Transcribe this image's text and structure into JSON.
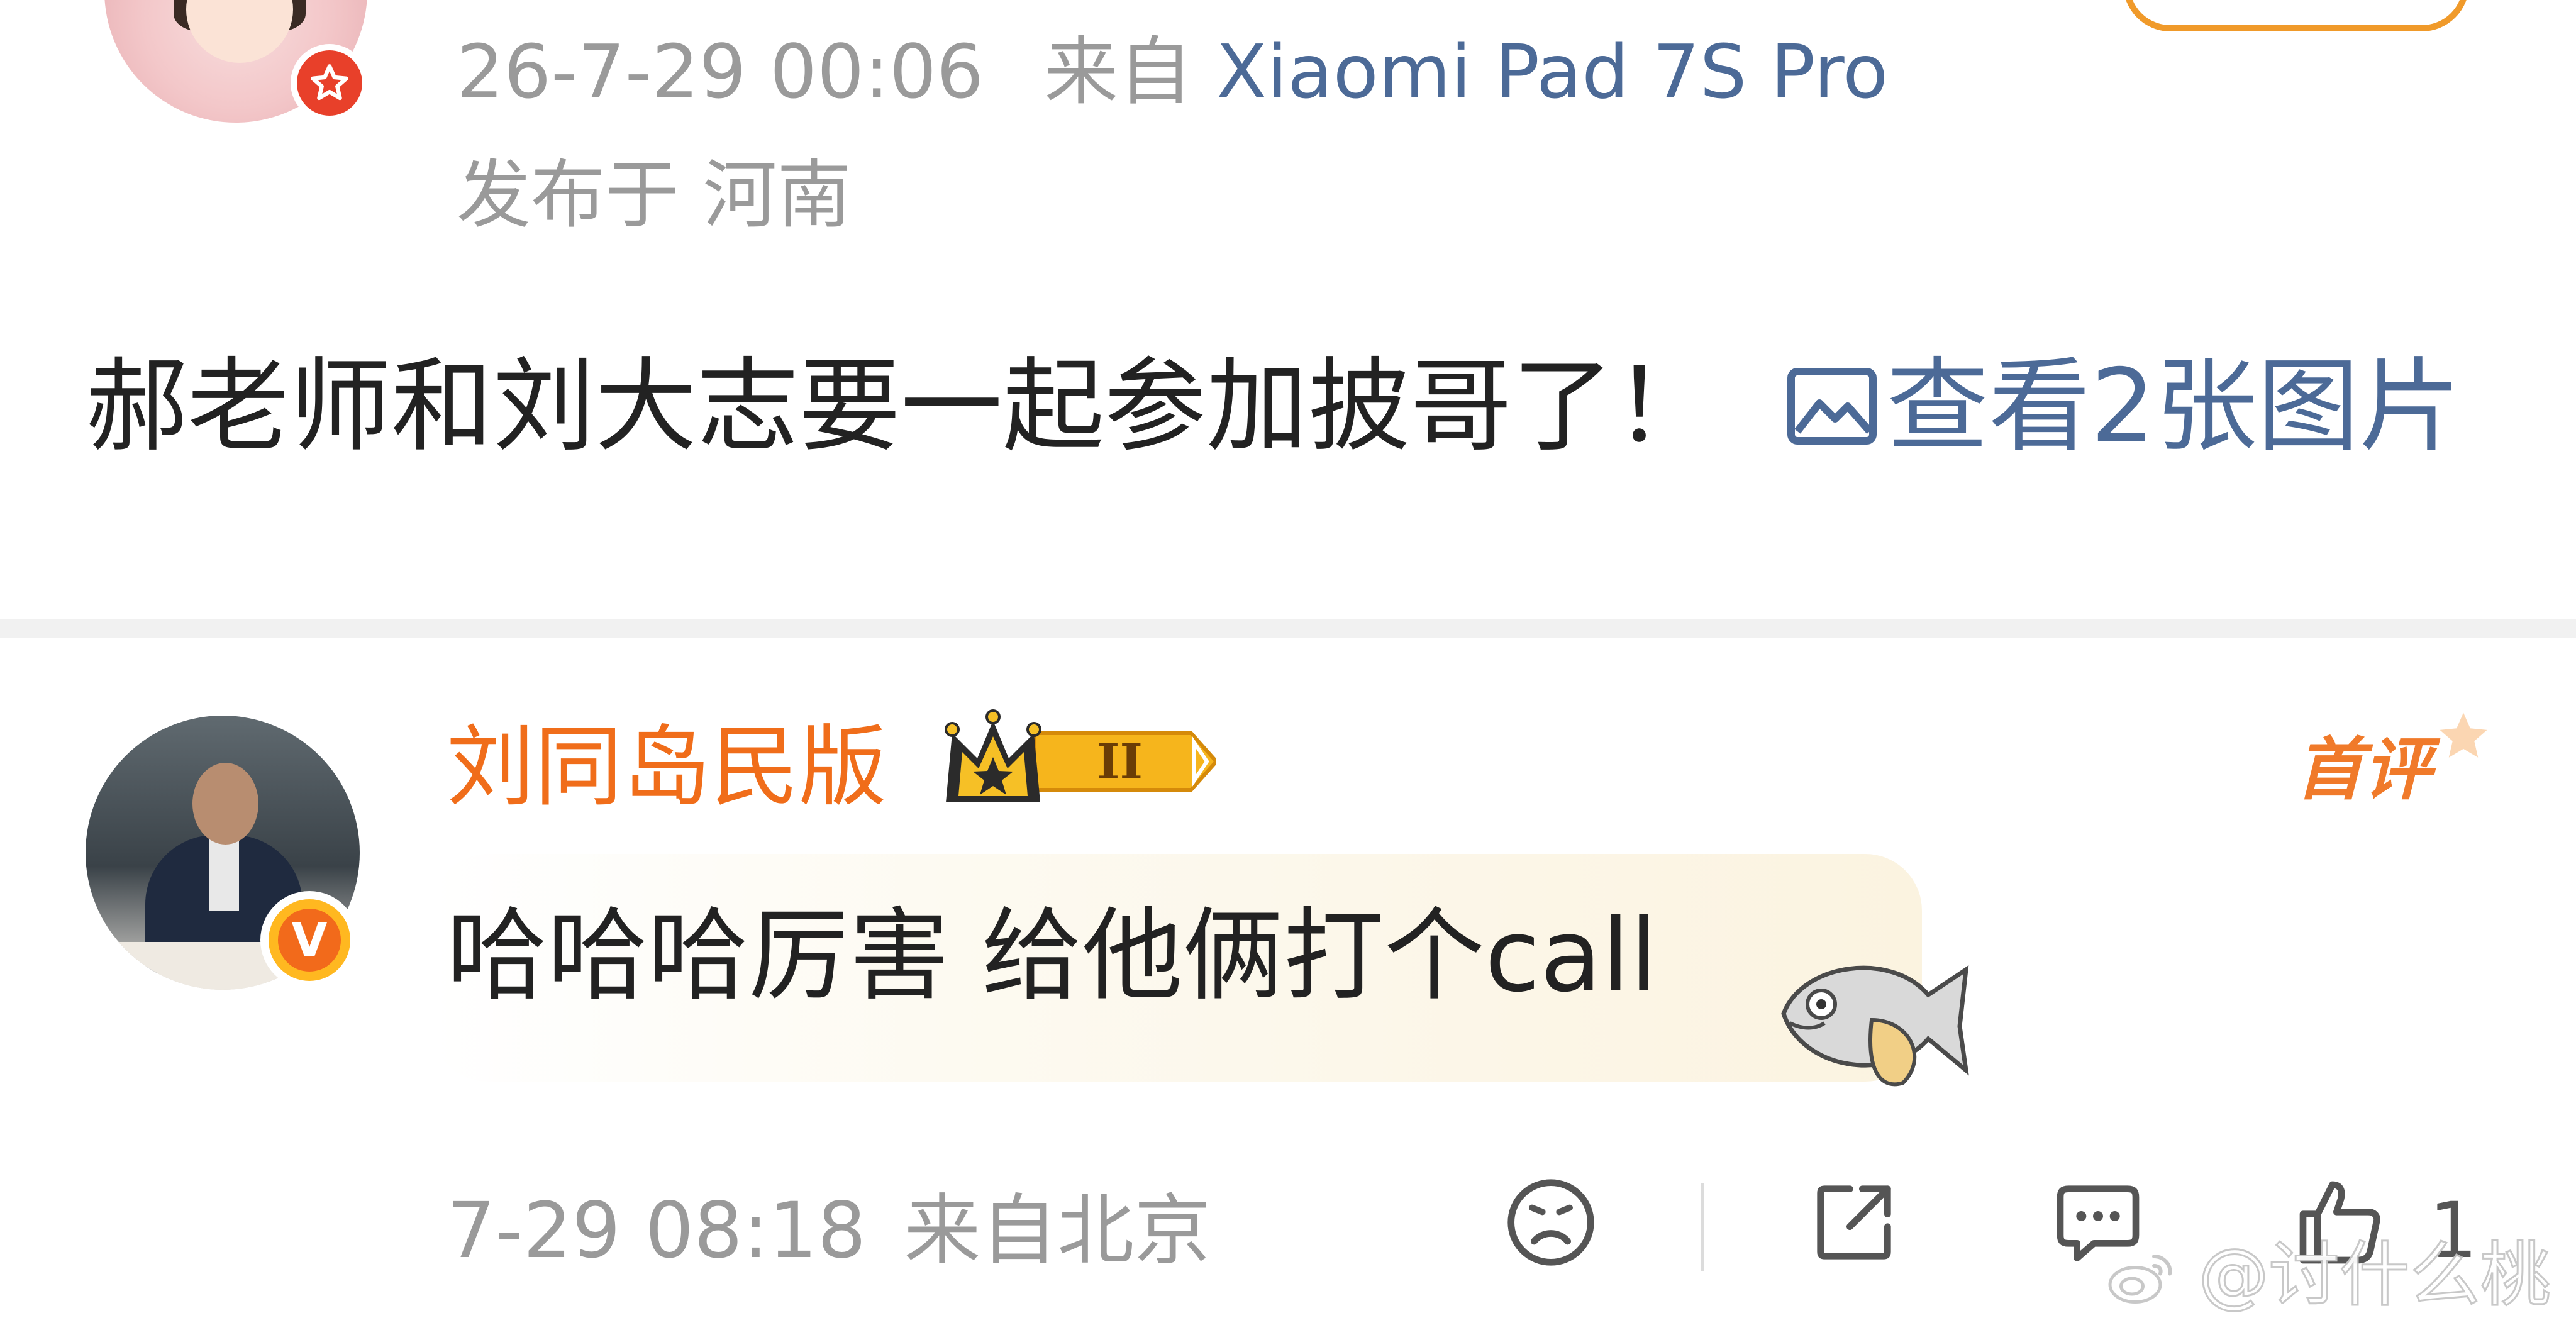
{
  "post": {
    "meta": {
      "time": "26-7-29 00:06",
      "from_label": "来自",
      "device": "Xiaomi Pad 7S Pro",
      "location": "发布于 河南"
    },
    "text": "郝老师和刘大志要一起参加披哥了！",
    "image_link": "查看2张图片",
    "icons": {
      "avatar": "user-avatar",
      "badge": "red-star-badge",
      "image": "image-icon"
    }
  },
  "comment": {
    "username": "刘同岛民版",
    "vip_level": "II",
    "first_label": "首评",
    "text": "哈哈哈厉害 给他俩打个call",
    "time": "7-29 08:18",
    "location": "来自北京",
    "like_count": "1",
    "icons": {
      "verified": "verified-v-badge",
      "vip": "vip-crown-badge",
      "sticker": "fish-sticker",
      "dislike": "frown-icon",
      "share": "share-icon",
      "reply": "comment-icon",
      "like": "thumbs-up-icon"
    }
  },
  "watermark": "@讨什么桃",
  "colors": {
    "link": "#4c6a97",
    "username": "#f06d1a",
    "meta": "#9a9a9a",
    "text": "#222222"
  }
}
